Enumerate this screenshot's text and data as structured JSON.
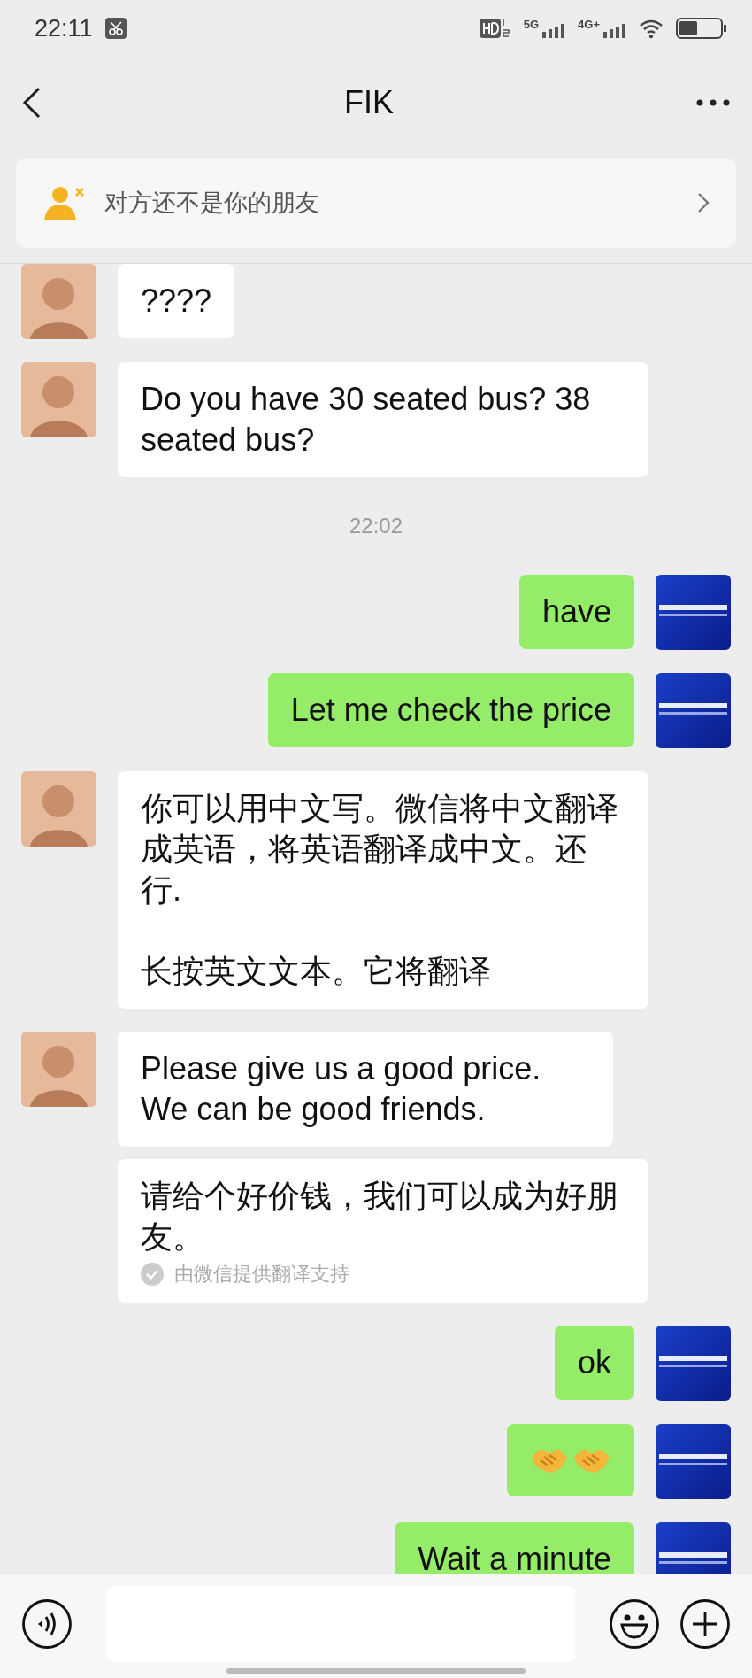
{
  "status_bar": {
    "time": "22:11",
    "network_1": "5G",
    "network_2": "4G+"
  },
  "header": {
    "title": "FIK"
  },
  "notice": {
    "text": "对方还不是你的朋友"
  },
  "messages": [
    {
      "kind": "text",
      "outgoing": false,
      "text": "????"
    },
    {
      "kind": "text",
      "outgoing": false,
      "text": "Do you have 30 seated bus? 38 seated bus?"
    },
    {
      "kind": "time",
      "text": "22:02"
    },
    {
      "kind": "text",
      "outgoing": true,
      "text": "have"
    },
    {
      "kind": "text",
      "outgoing": true,
      "text": "Let me check the price"
    },
    {
      "kind": "text",
      "outgoing": false,
      "text": "你可以用中文写。微信将中文翻译成英语，将英语翻译成中文。还行.\n\n长按英文文本。它将翻译"
    },
    {
      "kind": "translated",
      "outgoing": false,
      "text": "Please give us a good price. We can be good friends.",
      "translation": "请给个好价钱，我们可以成为好朋友。",
      "note": "由微信提供翻译支持"
    },
    {
      "kind": "text",
      "outgoing": true,
      "text": "ok"
    },
    {
      "kind": "handshakes",
      "outgoing": true
    },
    {
      "kind": "text",
      "outgoing": true,
      "text": "Wait a minute"
    }
  ]
}
